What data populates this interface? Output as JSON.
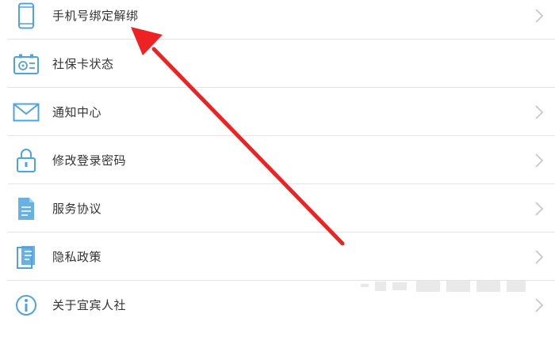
{
  "menu": {
    "items": [
      {
        "label": "手机号绑定解绑",
        "icon": "phone-icon",
        "has_chevron": true
      },
      {
        "label": "社保卡状态",
        "icon": "social-security-card-icon",
        "has_chevron": false
      },
      {
        "label": "通知中心",
        "icon": "envelope-icon",
        "has_chevron": true
      },
      {
        "label": "修改登录密码",
        "icon": "lock-icon",
        "has_chevron": true
      },
      {
        "label": "服务协议",
        "icon": "document-icon",
        "has_chevron": true
      },
      {
        "label": "隐私政策",
        "icon": "privacy-document-icon",
        "has_chevron": true
      },
      {
        "label": "关于宜宾人社",
        "icon": "info-icon",
        "has_chevron": true
      }
    ]
  },
  "colors": {
    "icon_blue": "#4fa3de",
    "text": "#333333",
    "divider": "#e4e4e4",
    "chevron": "#c8c8c8",
    "annotation_arrow": "#ee2222"
  }
}
